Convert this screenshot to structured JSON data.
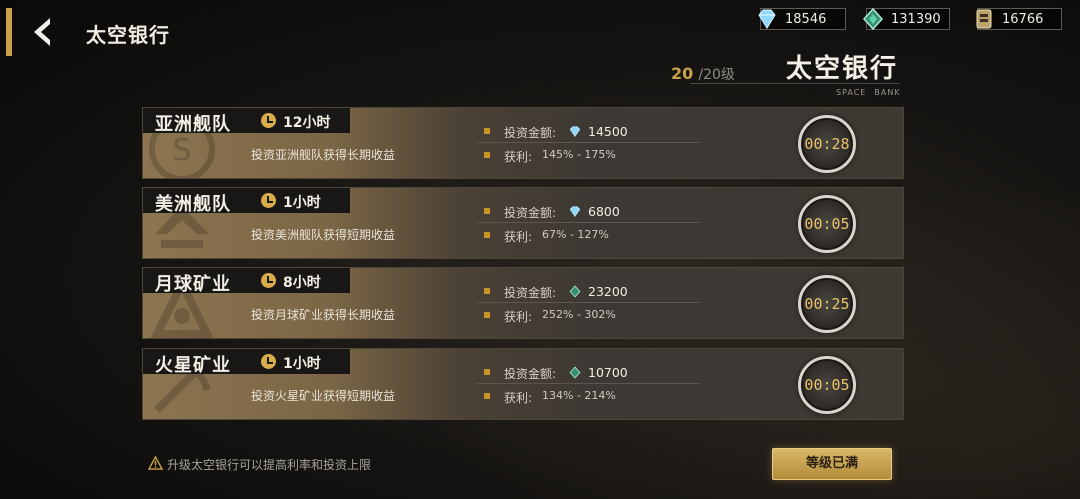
{
  "header": {
    "title": "太空银行",
    "resources": [
      {
        "icon": "diamond-icon",
        "value": "18546"
      },
      {
        "icon": "green-gem-icon",
        "value": "131390"
      },
      {
        "icon": "fuel-card-icon",
        "value": "16766"
      }
    ]
  },
  "bank": {
    "level_current": "20",
    "level_max": "/20级",
    "title": "太空银行",
    "subtitle_1": "SPACE",
    "subtitle_2": "BANK"
  },
  "investments": [
    {
      "name": "亚洲舰队",
      "duration": "12小时",
      "description": "投资亚洲舰队获得长期收益",
      "amount_label": "投资金额:",
      "currency_icon": "diamond-icon",
      "amount": "14500",
      "profit_label": "获利:",
      "profit": "145% - 175%",
      "timer": "00:28"
    },
    {
      "name": "美洲舰队",
      "duration": "1小时",
      "description": "投资美洲舰队获得短期收益",
      "amount_label": "投资金额:",
      "currency_icon": "diamond-icon",
      "amount": "6800",
      "profit_label": "获利:",
      "profit": "67% - 127%",
      "timer": "00:05"
    },
    {
      "name": "月球矿业",
      "duration": "8小时",
      "description": "投资月球矿业获得长期收益",
      "amount_label": "投资金额:",
      "currency_icon": "green-gem-icon",
      "amount": "23200",
      "profit_label": "获利:",
      "profit": "252% - 302%",
      "timer": "00:25"
    },
    {
      "name": "火星矿业",
      "duration": "1小时",
      "description": "投资火星矿业获得短期收益",
      "amount_label": "投资金额:",
      "currency_icon": "green-gem-icon",
      "amount": "10700",
      "profit_label": "获利:",
      "profit": "134% - 214%",
      "timer": "00:05"
    }
  ],
  "footer": {
    "hint": "升级太空银行可以提高利率和投资上限",
    "button_label": "等级已满"
  },
  "colors": {
    "accent_gold": "#c9a24a",
    "diamond": "#8fd8ff",
    "green_gem": "#5fd3a8"
  }
}
